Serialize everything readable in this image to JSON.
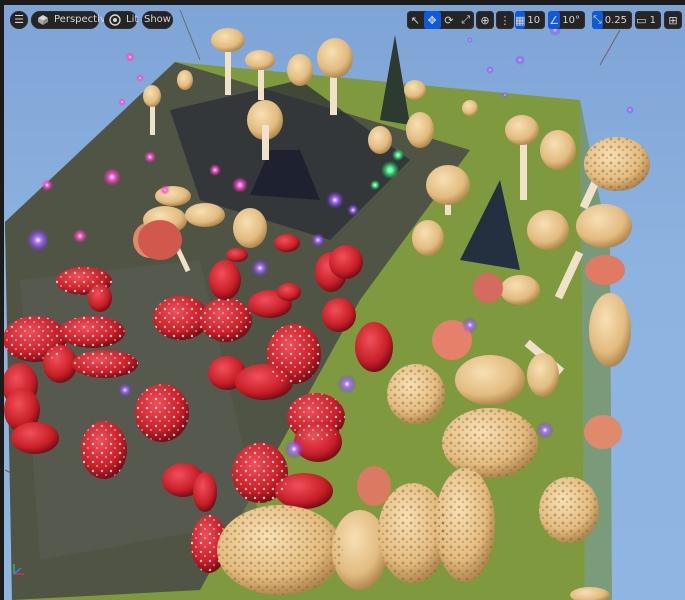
{
  "toolbar": {
    "view_mode": "Perspective",
    "lighting_mode": "Lit",
    "show_label": "Show",
    "grid_snap_value": "10",
    "rotation_snap_value": "10°",
    "scale_snap_value": "0.25",
    "camera_speed_value": "1"
  },
  "colors": {
    "ui_accent": "#0e5ad8",
    "toolbar_bg": "#252525",
    "sky": "#8db3e0",
    "moss": "#7f9a3e",
    "amanita_red": "#c81f28",
    "tan_cap": "#e9c58f"
  },
  "icons": [
    "menu-icon",
    "perspective-icon",
    "lit-icon",
    "select-icon",
    "move-icon",
    "rotate-icon",
    "scale-icon",
    "world-icon",
    "surface-snap-icon",
    "grid-snap-icon",
    "rotation-snap-icon",
    "scale-snap-icon",
    "camera-icon",
    "maximize-icon"
  ]
}
